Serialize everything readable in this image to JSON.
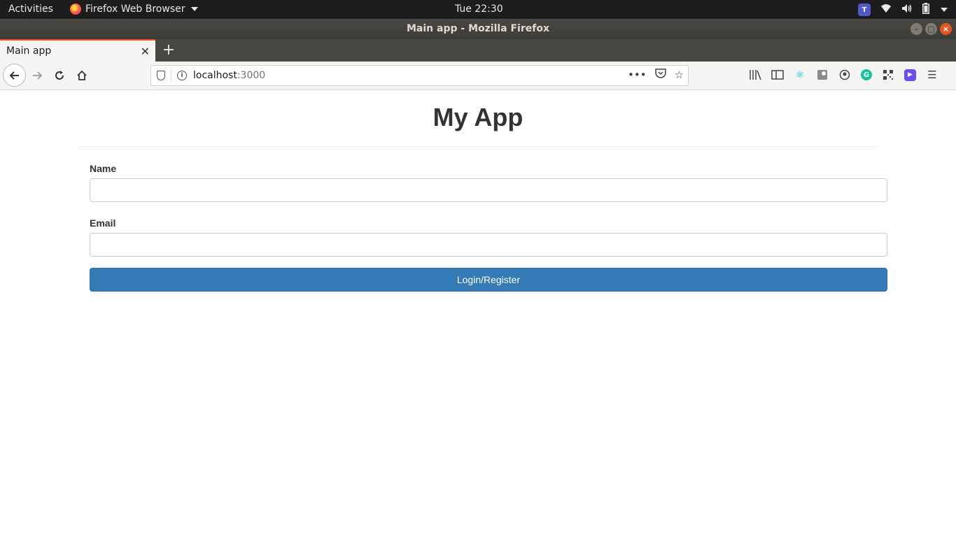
{
  "system_bar": {
    "activities": "Activities",
    "app_name": "Firefox Web Browser",
    "clock": "Tue 22:30",
    "tray_icons": [
      "teams-icon",
      "wifi-icon",
      "volume-icon",
      "battery-icon",
      "system-menu-icon"
    ]
  },
  "window": {
    "title": "Main app - Mozilla Firefox"
  },
  "tabs": [
    {
      "label": "Main app",
      "active": true
    }
  ],
  "nav": {
    "url_host": "localhost",
    "url_port": ":3000"
  },
  "toolbar_icons": [
    "library-icon",
    "sidebar-icon",
    "react-devtools-icon",
    "extension-icon",
    "account-icon",
    "grammarly-icon",
    "qr-code-icon",
    "zoom-icon",
    "menu-icon"
  ],
  "page": {
    "title": "My App",
    "form": {
      "name_label": "Name",
      "name_value": "",
      "email_label": "Email",
      "email_value": "",
      "submit_label": "Login/Register"
    }
  },
  "colors": {
    "accent_tab": "#e95420",
    "primary_button": "#337ab7"
  }
}
